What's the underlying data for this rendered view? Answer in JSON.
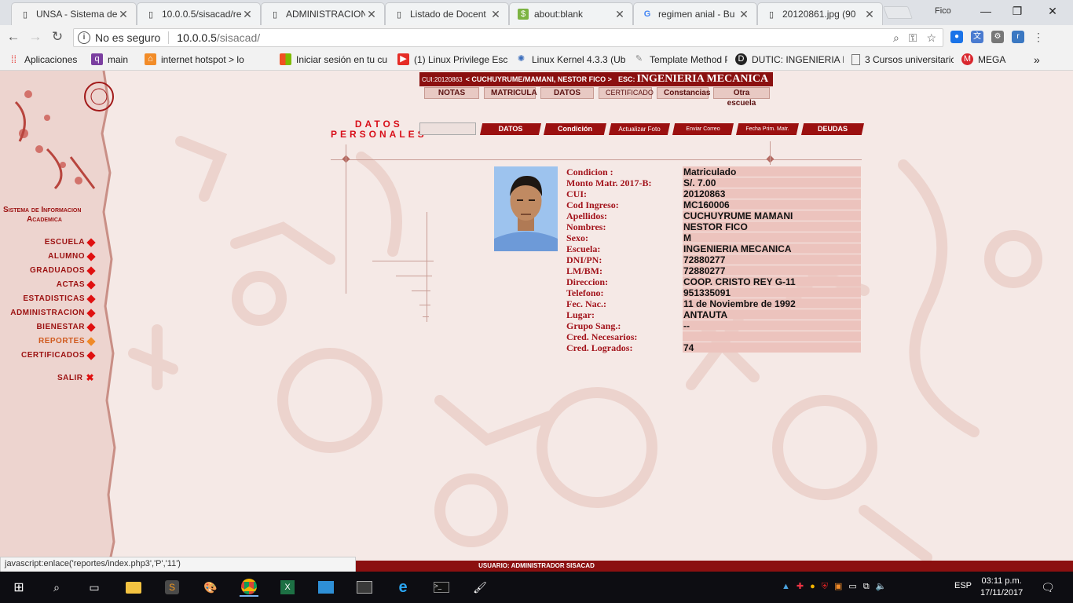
{
  "browser": {
    "tabs": [
      {
        "title": "UNSA - Sistema de",
        "icon": "document-icon",
        "active": true
      },
      {
        "title": "10.0.0.5/sisacad/re",
        "icon": "document-icon"
      },
      {
        "title": "ADMINISTRACION",
        "icon": "document-icon"
      },
      {
        "title": "Listado de Docent",
        "icon": "document-icon"
      },
      {
        "title": "about:blank",
        "icon": "dollar-icon"
      },
      {
        "title": "regimen anial - Bu",
        "icon": "google-icon"
      },
      {
        "title": "20120861.jpg (90",
        "icon": "document-icon"
      }
    ],
    "profile_name": "Fico",
    "address": {
      "secure_label": "No es seguro",
      "host": "10.0.0.5",
      "path": "/sisacad/"
    },
    "bookmarks": [
      {
        "label": "Aplicaciones",
        "icon": "apps-grid-icon",
        "color": "#e53935"
      },
      {
        "label": "main",
        "icon": "chat-icon",
        "color": "#7b3fa0"
      },
      {
        "label": "internet hotspot > lo",
        "icon": "hotspot-icon",
        "color": "#f28c28"
      },
      {
        "label": "Iniciar sesión en tu cu",
        "icon": "document-icon",
        "color": "#777777"
      },
      {
        "label": "(1) Linux Privilege Esc",
        "icon": "windows-icon",
        "color": "#00a4ef"
      },
      {
        "label": "Linux Kernel 4.3.3 (Ub",
        "icon": "youtube-icon",
        "color": "#e52d27"
      },
      {
        "label": "Template Method Pat",
        "icon": "atom-icon",
        "color": "#3a6dbc"
      },
      {
        "label": "DUTIC: INGENIERIA M",
        "icon": "pattern-icon",
        "color": "#888888"
      },
      {
        "label": "3 Cursos universitaric",
        "icon": "dutic-icon",
        "color": "#222222"
      },
      {
        "label": "MEGA",
        "icon": "document-icon",
        "color": "#777777"
      }
    ]
  },
  "sisacad": {
    "sidebar_title_line1": "Sistema de Informacion",
    "sidebar_title_line2": "Academica",
    "menu": [
      {
        "label": "ESCUELA"
      },
      {
        "label": "ALUMNO"
      },
      {
        "label": "GRADUADOS"
      },
      {
        "label": "ACTAS"
      },
      {
        "label": "ESTADISTICAS"
      },
      {
        "label": "ADMINISTRACION"
      },
      {
        "label": "BIENESTAR"
      },
      {
        "label": "REPORTES"
      },
      {
        "label": "CERTIFICADOS"
      },
      {
        "label": "SALIR"
      }
    ],
    "header": {
      "cui_text": "CUI:20120863",
      "student_text": "< CUCHUYRUME/MAMANI, NESTOR FICO >",
      "esc_prefix": "ESC:",
      "escuela": "INGENIERIA MECANICA"
    },
    "top_nav": [
      "NOTAS",
      "MATRICULA",
      "DATOS",
      "CERTIFICADO",
      "Constancias",
      "Otra escuela"
    ],
    "section_title_line1": "DATOS",
    "section_title_line2": "PERSONALES",
    "sub_nav": [
      "DATOS",
      "Condición",
      "Actualizar Foto",
      "Enviar Correo",
      "Fecha Prim. Matr.",
      "DEUDAS"
    ],
    "fields": [
      {
        "label": "Condicion :",
        "value": "Matriculado"
      },
      {
        "label": "Monto Matr. 2017-B:",
        "value": "S/. 7.00"
      },
      {
        "label": "CUI:",
        "value": "20120863"
      },
      {
        "label": "Cod Ingreso:",
        "value": "MC160006"
      },
      {
        "label": "Apellidos:",
        "value": "CUCHUYRUME MAMANI"
      },
      {
        "label": "Nombres:",
        "value": "NESTOR FICO"
      },
      {
        "label": "Sexo:",
        "value": "M"
      },
      {
        "label": "Escuela:",
        "value": "INGENIERIA MECANICA"
      },
      {
        "label": "DNI/PN:",
        "value": "72880277"
      },
      {
        "label": "LM/BM:",
        "value": "72880277"
      },
      {
        "label": "Direccion:",
        "value": "COOP. CRISTO REY G-11"
      },
      {
        "label": "Telefono:",
        "value": "951335091"
      },
      {
        "label": "Fec. Nac.:",
        "value": "11 de Noviembre de 1992"
      },
      {
        "label": "Lugar:",
        "value": "ANTAUTA"
      },
      {
        "label": "Grupo Sang.:",
        "value": "--"
      },
      {
        "label": "Cred. Necesarios:",
        "value": ""
      },
      {
        "label": "Cred. Logrados:",
        "value": "74"
      }
    ],
    "footer": "USUARIO: ADMINISTRADOR SISACAD"
  },
  "status_url": "javascript:enlace('reportes/index.php3','P','11')",
  "taskbar": {
    "language": "ESP",
    "time": "03:11 p.m.",
    "date": "17/11/2017"
  },
  "colors": {
    "brand": "#8b1010",
    "accent": "#d8101a",
    "field_bg": "#ecc3bd"
  }
}
